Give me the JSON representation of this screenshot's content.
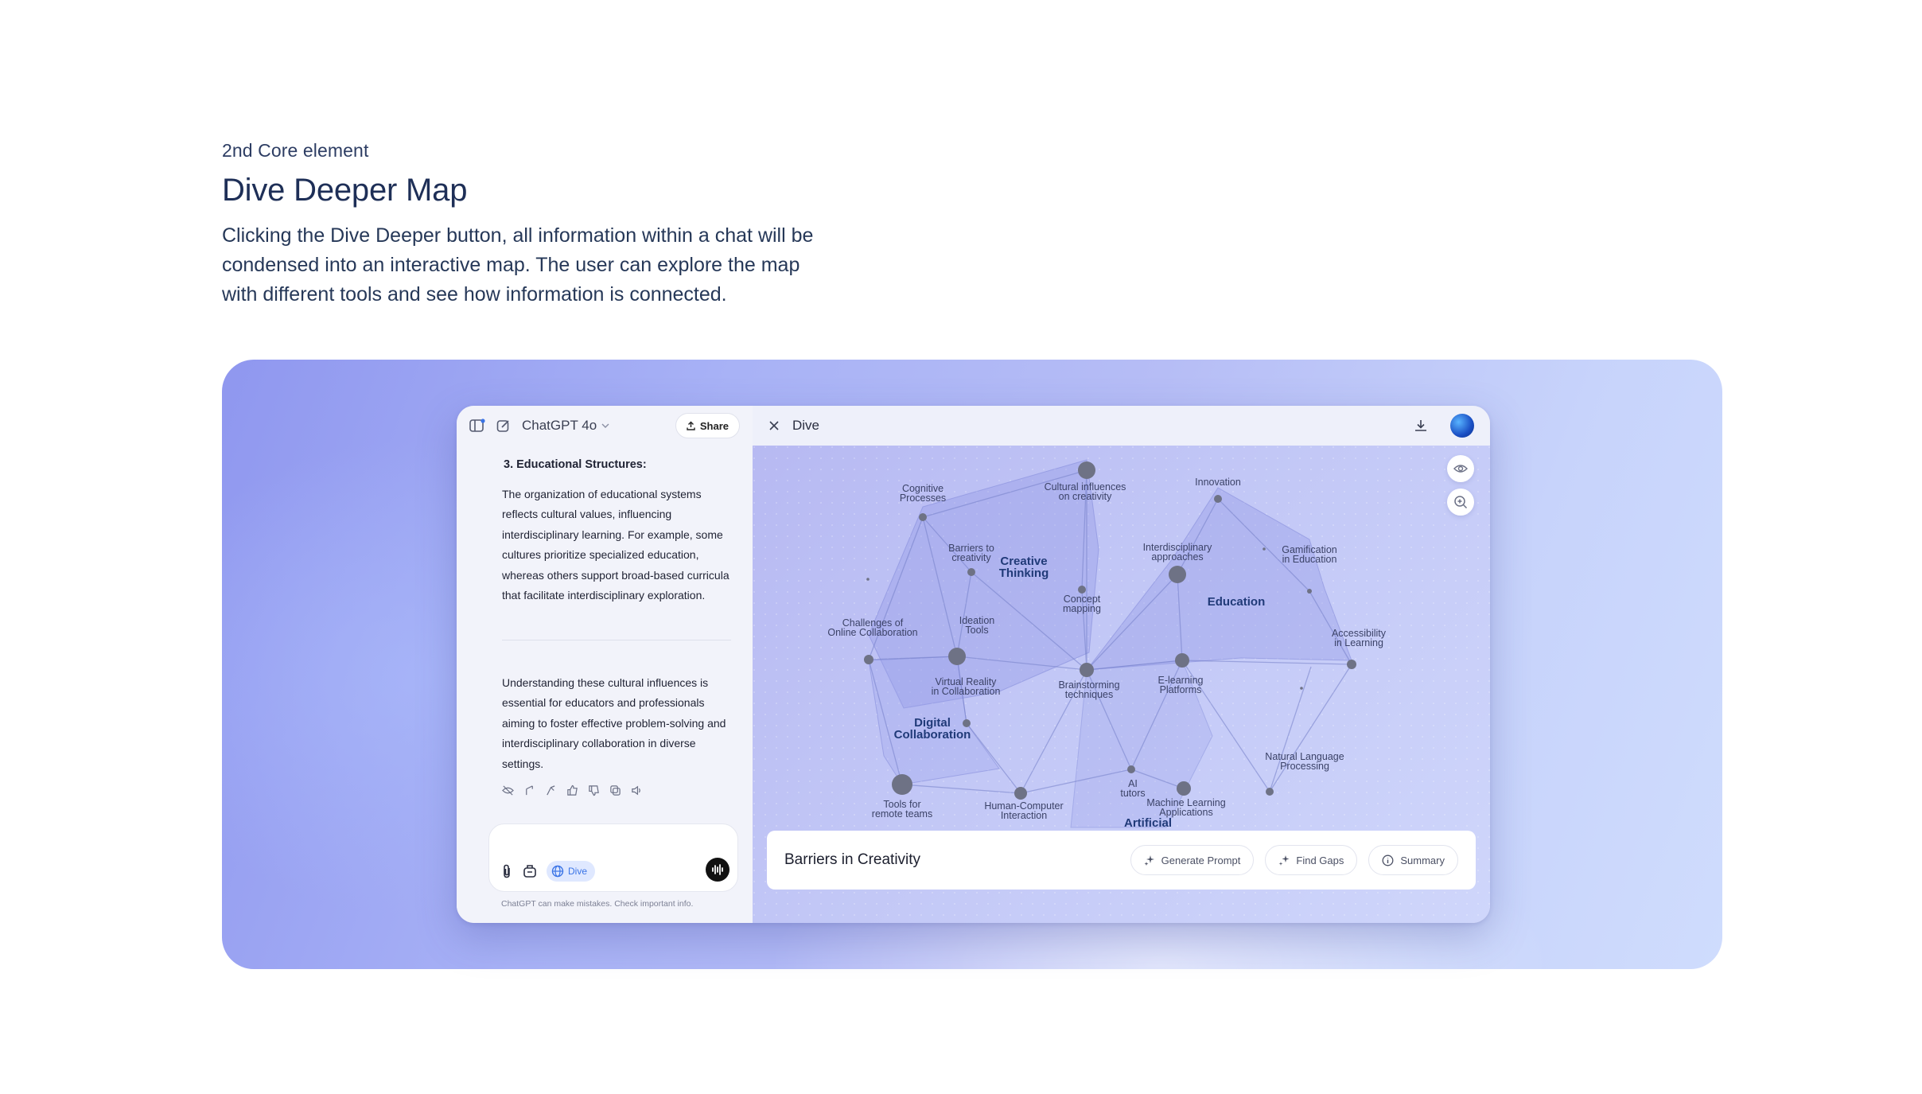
{
  "intro": {
    "eyebrow": "2nd Core element",
    "title": "Dive Deeper Map",
    "description": "Clicking the Dive Deeper button, all information within a chat will be condensed into an interactive map. The user can explore the map with different tools and see how information is connected."
  },
  "chat": {
    "model_label": "ChatGPT 4o",
    "share_label": "Share",
    "section_heading": "3. Educational Structures:",
    "paragraph_1": "The organization of educational systems reflects cultural values, influencing interdisciplinary learning. For example, some cultures prioritize specialized education, whereas others support broad-based curricula that facilitate interdisciplinary exploration.",
    "paragraph_2": "Understanding these cultural influences is essential for educators and professionals aiming to foster effective problem-solving and interdisciplinary collaboration in diverse settings.",
    "dive_label": "Dive",
    "disclaimer": "ChatGPT can make mistakes. Check important info."
  },
  "map": {
    "title": "Dive",
    "selected_title": "Barriers in Creativity",
    "buttons": {
      "generate_prompt": "Generate Prompt",
      "find_gaps": "Find Gaps",
      "summary": "Summary"
    },
    "clusters": {
      "creative": "Creative Thinking",
      "education": "Education",
      "digital": "Digital Collaboration",
      "artificial": "Artificial"
    },
    "nodes": {
      "cognitive": "Cognitive Processes",
      "cultural": "Cultural influences on creativity",
      "innovation": "Innovation",
      "barriers": "Barriers to creativity",
      "interdisciplinary": "Interdisciplinary approaches",
      "gamification": "Gamification in Education",
      "concept": "Concept mapping",
      "challenges": "Challenges of Online Collaboration",
      "ideation": "Ideation Tools",
      "accessibility": "Accessibility in Learning",
      "vr": "Virtual Reality in Collaboration",
      "brainstorming": "Brainstorming techniques",
      "elearning": "E-learning Platforms",
      "nlp": "Natural Language Processing",
      "tools": "Tools for remote teams",
      "hci": "Human-Computer Interaction",
      "ai_tutors": "AI tutors",
      "ml": "Machine Learning Applications"
    }
  }
}
